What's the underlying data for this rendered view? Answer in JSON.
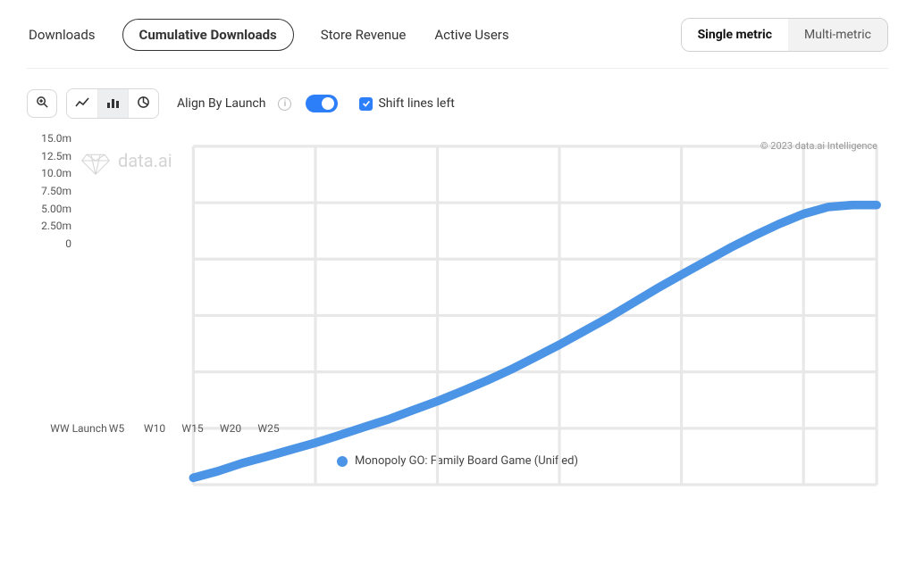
{
  "tabs": {
    "downloads": "Downloads",
    "cumulative": "Cumulative Downloads",
    "revenue": "Store Revenue",
    "active_users": "Active Users"
  },
  "metric": {
    "single": "Single metric",
    "multi": "Multi-metric"
  },
  "colors": {
    "series1": "#4b94e6",
    "accent": "#2d7ff9",
    "grid": "#e8e8e8",
    "axis_text": "#555"
  },
  "controls": {
    "align_label": "Align By Launch",
    "info_char": "i",
    "shift_label": "Shift lines left",
    "shift_checked": true
  },
  "watermark_text": "data.ai",
  "copyright": "© 2023 data.ai Intelligence",
  "legend": {
    "series1": "Monopoly GO: Family Board Game (Unified)"
  },
  "chart_data": {
    "type": "line",
    "title": "",
    "xlabel": "",
    "ylabel": "",
    "ylim": [
      0,
      15.0
    ],
    "y_unit": "m",
    "y_ticks": [
      0,
      2.5,
      5.0,
      7.5,
      10.0,
      12.5,
      15.0
    ],
    "y_tick_labels": [
      "0",
      "2.50m",
      "5.00m",
      "7.50m",
      "10.0m",
      "12.5m",
      "15.0m"
    ],
    "x_tick_labels": [
      "WW Launch",
      "W5",
      "W10",
      "W15",
      "W20",
      "W25"
    ],
    "x_tick_positions": [
      0,
      5,
      10,
      15,
      20,
      25
    ],
    "x_range": [
      0,
      28
    ],
    "series": [
      {
        "name": "Monopoly GO: Family Board Game (Unified)",
        "color": "#4b94e6",
        "x": [
          0,
          1,
          2,
          3,
          4,
          5,
          6,
          7,
          8,
          9,
          10,
          11,
          12,
          13,
          14,
          15,
          16,
          17,
          18,
          19,
          20,
          21,
          22,
          23,
          24,
          25,
          26,
          27,
          28
        ],
        "values": [
          0.3,
          0.6,
          0.95,
          1.25,
          1.55,
          1.85,
          2.2,
          2.55,
          2.9,
          3.3,
          3.7,
          4.15,
          4.6,
          5.1,
          5.65,
          6.2,
          6.8,
          7.4,
          8.05,
          8.7,
          9.3,
          9.9,
          10.5,
          11.05,
          11.55,
          12.0,
          12.3,
          12.4,
          12.4
        ]
      }
    ]
  }
}
